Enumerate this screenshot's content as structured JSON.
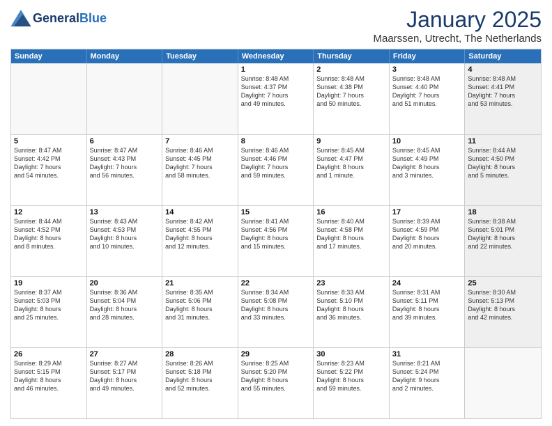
{
  "header": {
    "logo_general": "General",
    "logo_blue": "Blue",
    "title": "January 2025",
    "subtitle": "Maarssen, Utrecht, The Netherlands"
  },
  "calendar": {
    "days_of_week": [
      "Sunday",
      "Monday",
      "Tuesday",
      "Wednesday",
      "Thursday",
      "Friday",
      "Saturday"
    ],
    "weeks": [
      [
        {
          "day": "",
          "info": "",
          "empty": true
        },
        {
          "day": "",
          "info": "",
          "empty": true
        },
        {
          "day": "",
          "info": "",
          "empty": true
        },
        {
          "day": "1",
          "info": "Sunrise: 8:48 AM\nSunset: 4:37 PM\nDaylight: 7 hours\nand 49 minutes.",
          "empty": false
        },
        {
          "day": "2",
          "info": "Sunrise: 8:48 AM\nSunset: 4:38 PM\nDaylight: 7 hours\nand 50 minutes.",
          "empty": false
        },
        {
          "day": "3",
          "info": "Sunrise: 8:48 AM\nSunset: 4:40 PM\nDaylight: 7 hours\nand 51 minutes.",
          "empty": false
        },
        {
          "day": "4",
          "info": "Sunrise: 8:48 AM\nSunset: 4:41 PM\nDaylight: 7 hours\nand 53 minutes.",
          "empty": false,
          "shaded": true
        }
      ],
      [
        {
          "day": "5",
          "info": "Sunrise: 8:47 AM\nSunset: 4:42 PM\nDaylight: 7 hours\nand 54 minutes.",
          "empty": false
        },
        {
          "day": "6",
          "info": "Sunrise: 8:47 AM\nSunset: 4:43 PM\nDaylight: 7 hours\nand 56 minutes.",
          "empty": false
        },
        {
          "day": "7",
          "info": "Sunrise: 8:46 AM\nSunset: 4:45 PM\nDaylight: 7 hours\nand 58 minutes.",
          "empty": false
        },
        {
          "day": "8",
          "info": "Sunrise: 8:46 AM\nSunset: 4:46 PM\nDaylight: 7 hours\nand 59 minutes.",
          "empty": false
        },
        {
          "day": "9",
          "info": "Sunrise: 8:45 AM\nSunset: 4:47 PM\nDaylight: 8 hours\nand 1 minute.",
          "empty": false
        },
        {
          "day": "10",
          "info": "Sunrise: 8:45 AM\nSunset: 4:49 PM\nDaylight: 8 hours\nand 3 minutes.",
          "empty": false
        },
        {
          "day": "11",
          "info": "Sunrise: 8:44 AM\nSunset: 4:50 PM\nDaylight: 8 hours\nand 5 minutes.",
          "empty": false,
          "shaded": true
        }
      ],
      [
        {
          "day": "12",
          "info": "Sunrise: 8:44 AM\nSunset: 4:52 PM\nDaylight: 8 hours\nand 8 minutes.",
          "empty": false
        },
        {
          "day": "13",
          "info": "Sunrise: 8:43 AM\nSunset: 4:53 PM\nDaylight: 8 hours\nand 10 minutes.",
          "empty": false
        },
        {
          "day": "14",
          "info": "Sunrise: 8:42 AM\nSunset: 4:55 PM\nDaylight: 8 hours\nand 12 minutes.",
          "empty": false
        },
        {
          "day": "15",
          "info": "Sunrise: 8:41 AM\nSunset: 4:56 PM\nDaylight: 8 hours\nand 15 minutes.",
          "empty": false
        },
        {
          "day": "16",
          "info": "Sunrise: 8:40 AM\nSunset: 4:58 PM\nDaylight: 8 hours\nand 17 minutes.",
          "empty": false
        },
        {
          "day": "17",
          "info": "Sunrise: 8:39 AM\nSunset: 4:59 PM\nDaylight: 8 hours\nand 20 minutes.",
          "empty": false
        },
        {
          "day": "18",
          "info": "Sunrise: 8:38 AM\nSunset: 5:01 PM\nDaylight: 8 hours\nand 22 minutes.",
          "empty": false,
          "shaded": true
        }
      ],
      [
        {
          "day": "19",
          "info": "Sunrise: 8:37 AM\nSunset: 5:03 PM\nDaylight: 8 hours\nand 25 minutes.",
          "empty": false
        },
        {
          "day": "20",
          "info": "Sunrise: 8:36 AM\nSunset: 5:04 PM\nDaylight: 8 hours\nand 28 minutes.",
          "empty": false
        },
        {
          "day": "21",
          "info": "Sunrise: 8:35 AM\nSunset: 5:06 PM\nDaylight: 8 hours\nand 31 minutes.",
          "empty": false
        },
        {
          "day": "22",
          "info": "Sunrise: 8:34 AM\nSunset: 5:08 PM\nDaylight: 8 hours\nand 33 minutes.",
          "empty": false
        },
        {
          "day": "23",
          "info": "Sunrise: 8:33 AM\nSunset: 5:10 PM\nDaylight: 8 hours\nand 36 minutes.",
          "empty": false
        },
        {
          "day": "24",
          "info": "Sunrise: 8:31 AM\nSunset: 5:11 PM\nDaylight: 8 hours\nand 39 minutes.",
          "empty": false
        },
        {
          "day": "25",
          "info": "Sunrise: 8:30 AM\nSunset: 5:13 PM\nDaylight: 8 hours\nand 42 minutes.",
          "empty": false,
          "shaded": true
        }
      ],
      [
        {
          "day": "26",
          "info": "Sunrise: 8:29 AM\nSunset: 5:15 PM\nDaylight: 8 hours\nand 46 minutes.",
          "empty": false
        },
        {
          "day": "27",
          "info": "Sunrise: 8:27 AM\nSunset: 5:17 PM\nDaylight: 8 hours\nand 49 minutes.",
          "empty": false
        },
        {
          "day": "28",
          "info": "Sunrise: 8:26 AM\nSunset: 5:18 PM\nDaylight: 8 hours\nand 52 minutes.",
          "empty": false
        },
        {
          "day": "29",
          "info": "Sunrise: 8:25 AM\nSunset: 5:20 PM\nDaylight: 8 hours\nand 55 minutes.",
          "empty": false
        },
        {
          "day": "30",
          "info": "Sunrise: 8:23 AM\nSunset: 5:22 PM\nDaylight: 8 hours\nand 59 minutes.",
          "empty": false
        },
        {
          "day": "31",
          "info": "Sunrise: 8:21 AM\nSunset: 5:24 PM\nDaylight: 9 hours\nand 2 minutes.",
          "empty": false
        },
        {
          "day": "",
          "info": "",
          "empty": true,
          "shaded": true
        }
      ]
    ]
  }
}
